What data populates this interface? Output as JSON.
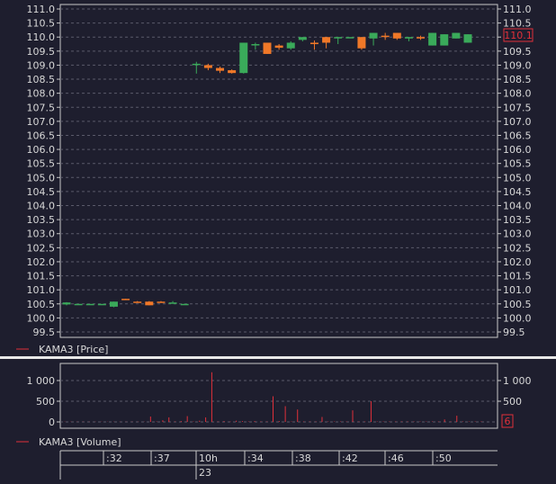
{
  "colors": {
    "background": "#1e1e2e",
    "grid": "#5a5a6a",
    "axis": "#c8c8c8",
    "text": "#d8d8d8",
    "up": "#3aaa5a",
    "down": "#f07828",
    "indicator": "#e0303a",
    "separator": "#e8e8e8"
  },
  "price_panel": {
    "legend_label": "KAMA3 [Price]",
    "last_price_badge": "110.1"
  },
  "volume_panel": {
    "legend_label": "KAMA3 [Volume]",
    "last_volume_badge": "6"
  },
  "time_axis": {
    "day_label": "10h",
    "date_label": "23"
  },
  "chart_data": [
    {
      "type": "candlestick",
      "title": "KAMA3 [Price]",
      "ylim": [
        99.5,
        111.0
      ],
      "y_ticks": [
        "111.0",
        "110.5",
        "110.0",
        "109.5",
        "109.0",
        "108.5",
        "108.0",
        "107.5",
        "107.0",
        "106.5",
        "106.0",
        "105.5",
        "105.0",
        "104.5",
        "104.0",
        "103.5",
        "103.0",
        "102.5",
        "102.0",
        "101.5",
        "101.0",
        "100.5",
        "100.0",
        "99.5"
      ],
      "x_ticks": [
        ":32",
        ":37",
        "10h",
        ":34",
        ":38",
        ":42",
        ":46",
        ":50"
      ],
      "grid": true,
      "last_value": 110.1,
      "candles": [
        {
          "i": 0,
          "open": 100.48,
          "high": 100.56,
          "low": 100.45,
          "close": 100.55
        },
        {
          "i": 1,
          "open": 100.5,
          "high": 100.5,
          "low": 100.5,
          "close": 100.5
        },
        {
          "i": 2,
          "open": 100.5,
          "high": 100.5,
          "low": 100.5,
          "close": 100.5
        },
        {
          "i": 3,
          "open": 100.5,
          "high": 100.5,
          "low": 100.5,
          "close": 100.5
        },
        {
          "i": 4,
          "open": 100.4,
          "high": 100.58,
          "low": 100.38,
          "close": 100.58
        },
        {
          "i": 5,
          "open": 100.68,
          "high": 100.68,
          "low": 100.65,
          "close": 100.65
        },
        {
          "i": 6,
          "open": 100.58,
          "high": 100.6,
          "low": 100.55,
          "close": 100.55
        },
        {
          "i": 7,
          "open": 100.58,
          "high": 100.6,
          "low": 100.45,
          "close": 100.45
        },
        {
          "i": 8,
          "open": 100.58,
          "high": 100.6,
          "low": 100.55,
          "close": 100.55
        },
        {
          "i": 9,
          "open": 100.55,
          "high": 100.6,
          "low": 100.55,
          "close": 100.55
        },
        {
          "i": 10,
          "open": 100.5,
          "high": 100.5,
          "low": 100.5,
          "close": 100.5
        },
        {
          "i": 11,
          "open": 109.05,
          "high": 109.12,
          "low": 108.7,
          "close": 109.05
        },
        {
          "i": 12,
          "open": 109.0,
          "high": 109.05,
          "low": 108.82,
          "close": 108.9
        },
        {
          "i": 13,
          "open": 108.9,
          "high": 108.95,
          "low": 108.72,
          "close": 108.8
        },
        {
          "i": 14,
          "open": 108.82,
          "high": 108.85,
          "low": 108.7,
          "close": 108.72
        },
        {
          "i": 15,
          "open": 108.72,
          "high": 109.8,
          "low": 108.7,
          "close": 109.8
        },
        {
          "i": 16,
          "open": 109.75,
          "high": 109.8,
          "low": 109.55,
          "close": 109.75
        },
        {
          "i": 17,
          "open": 109.8,
          "high": 109.8,
          "low": 109.4,
          "close": 109.4
        },
        {
          "i": 18,
          "open": 109.7,
          "high": 109.75,
          "low": 109.55,
          "close": 109.62
        },
        {
          "i": 19,
          "open": 109.6,
          "high": 109.85,
          "low": 109.55,
          "close": 109.8
        },
        {
          "i": 20,
          "open": 109.9,
          "high": 110.0,
          "low": 109.85,
          "close": 110.0
        },
        {
          "i": 21,
          "open": 109.8,
          "high": 109.88,
          "low": 109.55,
          "close": 109.75
        },
        {
          "i": 22,
          "open": 110.0,
          "high": 110.0,
          "low": 109.6,
          "close": 109.8
        },
        {
          "i": 23,
          "open": 110.0,
          "high": 110.0,
          "low": 109.75,
          "close": 110.0
        },
        {
          "i": 24,
          "open": 110.0,
          "high": 110.0,
          "low": 110.0,
          "close": 110.0
        },
        {
          "i": 25,
          "open": 110.0,
          "high": 110.0,
          "low": 109.55,
          "close": 109.6
        },
        {
          "i": 26,
          "open": 109.95,
          "high": 110.15,
          "low": 109.7,
          "close": 110.15
        },
        {
          "i": 27,
          "open": 110.05,
          "high": 110.15,
          "low": 109.9,
          "close": 110.0
        },
        {
          "i": 28,
          "open": 110.15,
          "high": 110.15,
          "low": 109.9,
          "close": 109.95
        },
        {
          "i": 29,
          "open": 109.95,
          "high": 110.0,
          "low": 109.85,
          "close": 110.0
        },
        {
          "i": 30,
          "open": 110.0,
          "high": 110.05,
          "low": 109.9,
          "close": 109.95
        },
        {
          "i": 31,
          "open": 109.7,
          "high": 110.15,
          "low": 109.7,
          "close": 110.15
        },
        {
          "i": 32,
          "open": 109.7,
          "high": 110.1,
          "low": 109.7,
          "close": 110.1
        },
        {
          "i": 33,
          "open": 109.95,
          "high": 110.15,
          "low": 109.95,
          "close": 110.15
        },
        {
          "i": 34,
          "open": 109.8,
          "high": 110.1,
          "low": 109.8,
          "close": 110.1
        }
      ]
    },
    {
      "type": "bar",
      "title": "KAMA3 [Volume]",
      "ylim": [
        0,
        1200
      ],
      "y_ticks": [
        "1 000",
        "500",
        "0"
      ],
      "grid": true,
      "last_value": 6,
      "values": [
        5,
        5,
        5,
        5,
        5,
        5,
        5,
        5,
        5,
        5,
        5,
        5,
        5,
        5,
        130,
        10,
        40,
        110,
        10,
        20,
        140,
        10,
        30,
        110,
        1200,
        10,
        20,
        10,
        30,
        20,
        10,
        20,
        10,
        10,
        620,
        20,
        380,
        10,
        300,
        10,
        10,
        10,
        120,
        10,
        10,
        10,
        10,
        280,
        10,
        10,
        500,
        10,
        10,
        10,
        10,
        10,
        10,
        10,
        10,
        10,
        10,
        10,
        60,
        10,
        150,
        10,
        10,
        10,
        10
      ]
    }
  ]
}
